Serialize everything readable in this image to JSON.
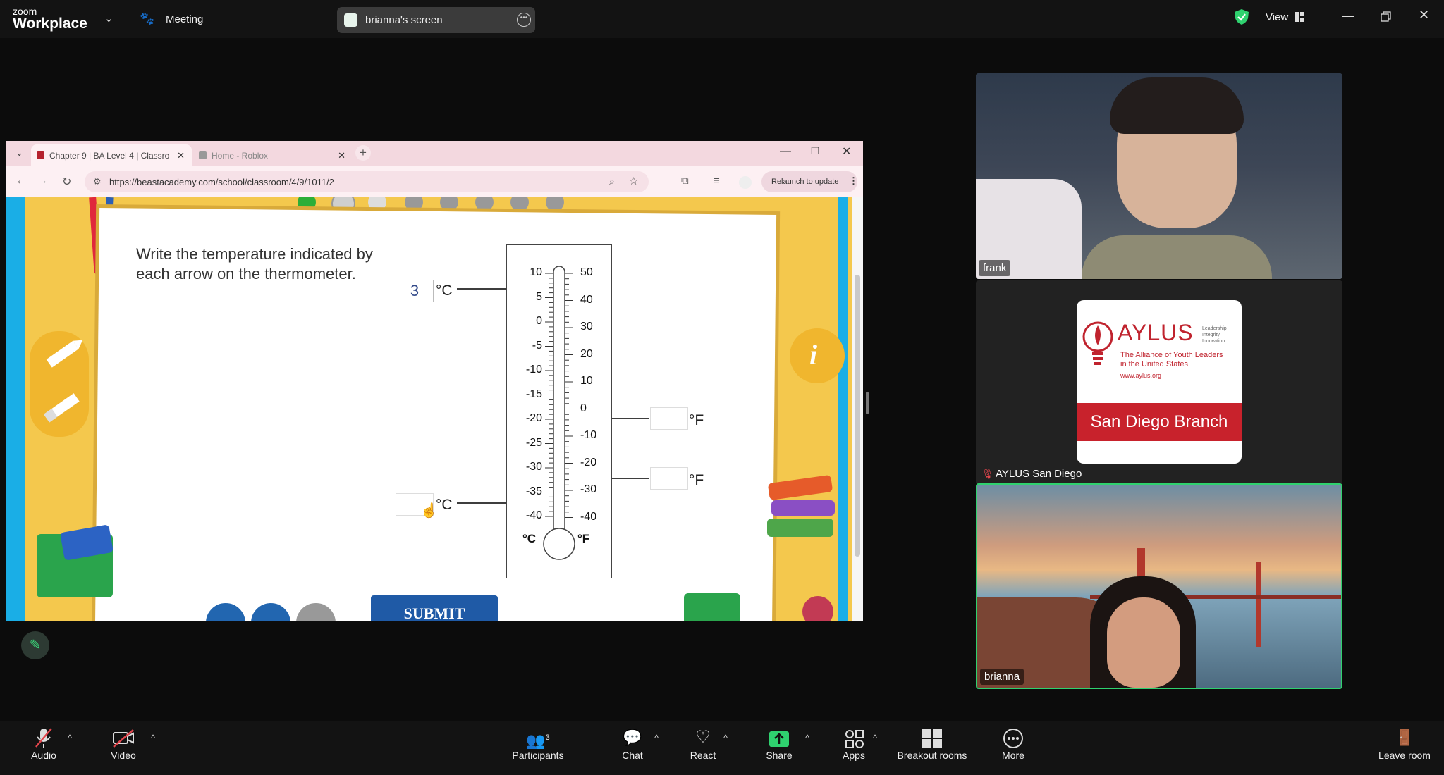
{
  "app": {
    "logo_top": "zoom",
    "logo_bottom": "Workplace",
    "meeting_label": "Meeting",
    "share_label": "brianna's screen",
    "view_label": "View",
    "shield_color": "#2fd16f"
  },
  "browser": {
    "tabs": [
      {
        "label": "Chapter 9 | BA Level 4 | Classro",
        "active": true
      },
      {
        "label": "Home - Roblox",
        "active": false
      }
    ],
    "url": "https://beastacademy.com/school/classroom/4/9/1011/2",
    "relaunch_label": "Relaunch to update"
  },
  "exercise": {
    "prompt_line1": "Write the temperature indicated by",
    "prompt_line2": "each arrow on the thermometer.",
    "answer1_value": "3",
    "answer1_unit": "°C",
    "answer2_value": "",
    "answer2_unit": "°F",
    "answer3_value": "",
    "answer3_unit": "°F",
    "answer4_value": "",
    "answer4_unit": "°C",
    "celsius_ticks": [
      "10",
      "5",
      "0",
      "-5",
      "-10",
      "-15",
      "-20",
      "-25",
      "-30",
      "-35",
      "-40"
    ],
    "fahrenheit_ticks": [
      "50",
      "40",
      "30",
      "20",
      "10",
      "0",
      "-10",
      "-20",
      "-30",
      "-40"
    ],
    "celsius_label": "°C",
    "fahrenheit_label": "°F",
    "submit_label": "SUBMIT"
  },
  "participants": {
    "frank": "frank",
    "aylus": "AYLUS San Diego",
    "brianna": "brianna",
    "aylus_logo": {
      "title": "AYLUS",
      "tagline": [
        "Leadership",
        "Integrity",
        "Innovation"
      ],
      "subtitle": [
        "The Alliance of Youth Leaders",
        "in the United States"
      ],
      "url": "www.aylus.org",
      "branch": "San Diego Branch"
    }
  },
  "toolbar": {
    "audio": "Audio",
    "video": "Video",
    "participants": "Participants",
    "participants_count": "3",
    "chat": "Chat",
    "react": "React",
    "share": "Share",
    "apps": "Apps",
    "breakout": "Breakout rooms",
    "more": "More",
    "leave": "Leave room"
  }
}
